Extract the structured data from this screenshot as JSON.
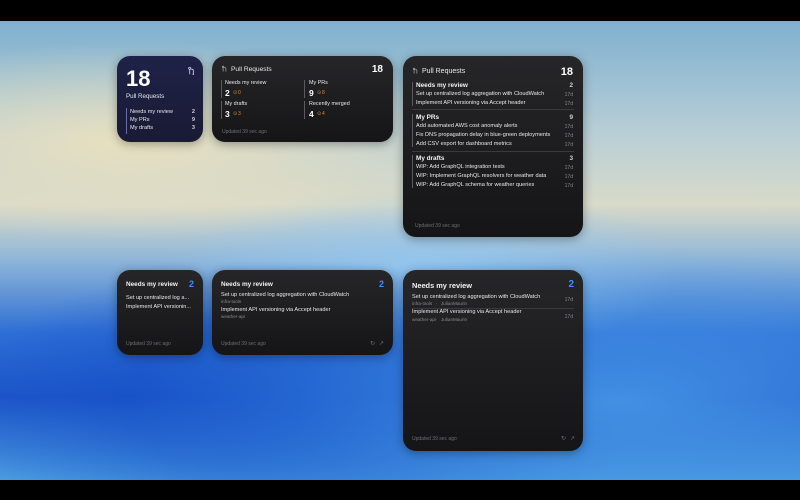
{
  "colors": {
    "accent_blue": "#3f8cff",
    "warn_orange": "#d08a3a",
    "widget_bg": "#1c1c1f",
    "widget_small_bg": "#1f2248"
  },
  "icons": {
    "brand": "pull-request-icon",
    "warn": "warning-icon",
    "refresh": "refresh-icon",
    "open": "open-external-icon"
  },
  "w1": {
    "total": "18",
    "title": "Pull Requests",
    "rows": [
      {
        "label": "Needs my review",
        "count": "2"
      },
      {
        "label": "My PRs",
        "count": "9"
      },
      {
        "label": "My drafts",
        "count": "3"
      }
    ]
  },
  "w2": {
    "title": "Pull Requests",
    "total": "18",
    "cells": [
      {
        "label": "Needs my review",
        "count": "2",
        "warn": "0"
      },
      {
        "label": "My PRs",
        "count": "9",
        "warn": "8"
      },
      {
        "label": "My drafts",
        "count": "3",
        "warn": "3"
      },
      {
        "label": "Recently merged",
        "count": "4",
        "warn": "4"
      }
    ],
    "footer": "Updated 39 sec ago"
  },
  "w3": {
    "title": "Pull Requests",
    "total": "18",
    "sections": [
      {
        "title": "Needs my review",
        "count": "2",
        "items": [
          {
            "text": "Set up centralized log aggregation with CloudWatch",
            "age": "17d"
          },
          {
            "text": "Implement API versioning via Accept header",
            "age": "17d"
          }
        ]
      },
      {
        "title": "My PRs",
        "count": "9",
        "items": [
          {
            "text": "Add automated AWS cost anomaly alerts",
            "age": "17d"
          },
          {
            "text": "Fix DNS propagation delay in blue-green deployments",
            "age": "17d"
          },
          {
            "text": "Add CSV export for dashboard metrics",
            "age": "17d"
          }
        ]
      },
      {
        "title": "My drafts",
        "count": "3",
        "items": [
          {
            "text": "WIP: Add GraphQL integration tests",
            "age": "17d"
          },
          {
            "text": "WIP: Implement GraphQL resolvers for weather data",
            "age": "17d"
          },
          {
            "text": "WIP: Add GraphQL schema for weather queries",
            "age": "17d"
          }
        ]
      }
    ],
    "footer": "Updated 39 sec ago"
  },
  "w4": {
    "title": "Needs my review",
    "count": "2",
    "items": [
      {
        "text": "Set up centralized log a..."
      },
      {
        "text": "Implement API versionin..."
      }
    ],
    "footer": "Updated 39 sec ago"
  },
  "w5": {
    "title": "Needs my review",
    "count": "2",
    "items": [
      {
        "text": "Set up centralized log aggregation with CloudWatch",
        "repo": "infra-tools"
      },
      {
        "text": "Implement API versioning via Accept header",
        "repo": "weather-api"
      }
    ],
    "footer": "Updated 39 sec ago"
  },
  "w6": {
    "title": "Needs my review",
    "count": "2",
    "items": [
      {
        "text": "Set up centralized log aggregation with CloudWatch",
        "repo": "infra-tools",
        "author": "JulianMaurin",
        "age": "17d"
      },
      {
        "text": "Implement API versioning via Accept header",
        "repo": "weather-api",
        "author": "JulianMaurin",
        "age": "17d"
      }
    ],
    "footer": "Updated 39 sec ago"
  }
}
